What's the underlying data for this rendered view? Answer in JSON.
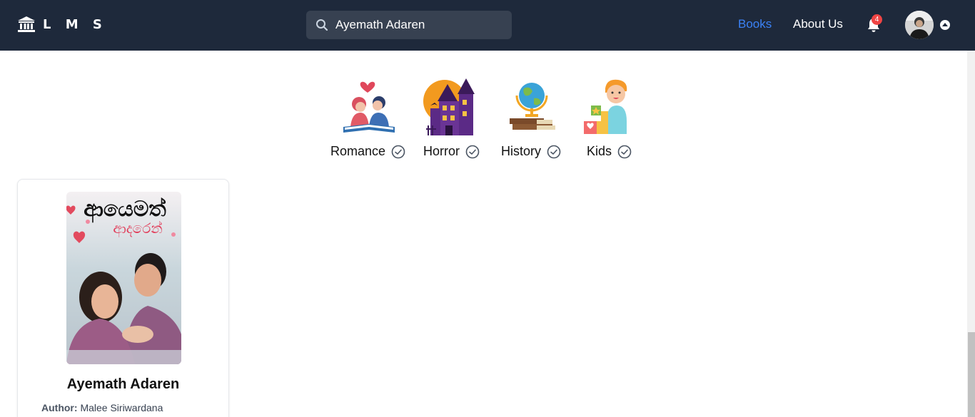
{
  "nav": {
    "brand": "L M S",
    "search_value": "Ayemath Adaren",
    "links": {
      "books": "Books",
      "about": "About Us"
    },
    "notification_count": "4"
  },
  "categories": [
    {
      "label": "Romance",
      "icon": "romance-icon"
    },
    {
      "label": "Horror",
      "icon": "haunted-house-icon"
    },
    {
      "label": "History",
      "icon": "globe-books-icon"
    },
    {
      "label": "Kids",
      "icon": "kid-blocks-icon"
    }
  ],
  "book": {
    "title": "Ayemath Adaren",
    "author_label": "Author:",
    "author": "Malee Siriwardana",
    "cover_text_line1": "ආයෙමත්",
    "cover_text_line2": "ආදරෙන්"
  },
  "colors": {
    "navbar": "#1e293b",
    "accent": "#3b82f6",
    "badge": "#ef4444"
  }
}
